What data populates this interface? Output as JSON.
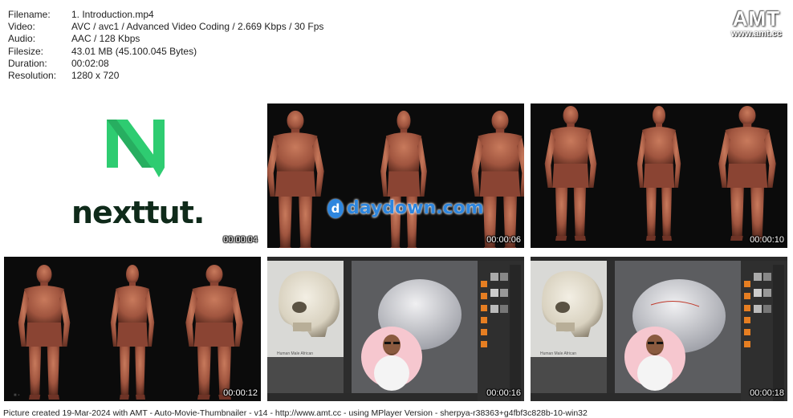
{
  "info": {
    "rows": [
      {
        "k": "Filename:",
        "v": "1. Introduction.mp4"
      },
      {
        "k": "Video:",
        "v": "AVC / avc1 / Advanced Video Coding / 2.669 Kbps / 30 Fps"
      },
      {
        "k": "Audio:",
        "v": "AAC / 128 Kbps"
      },
      {
        "k": "Filesize:",
        "v": "43.01 MB (45.100.045 Bytes)"
      },
      {
        "k": "Duration:",
        "v": "00:02:08"
      },
      {
        "k": "Resolution:",
        "v": "1280 x 720"
      }
    ]
  },
  "watermark": {
    "big": "AMT",
    "small": "www.amt.cc"
  },
  "thumbs": [
    {
      "time": "00:00:04",
      "logo_text": "nexttut."
    },
    {
      "time": "00:00:06",
      "overlay": "daydown.com"
    },
    {
      "time": "00:00:10"
    },
    {
      "time": "00:00:12"
    },
    {
      "time": "00:00:16",
      "caption": "Human Male African"
    },
    {
      "time": "00:00:18",
      "caption": "Human Male African"
    }
  ],
  "footer": "Picture created 19-Mar-2024 with AMT - Auto-Movie-Thumbnailer - v14 - http://www.amt.cc - using MPlayer Version - sherpya-r38363+g4fbf3c828b-10-win32",
  "colors": {
    "brand_green": "#2ecc71",
    "logo_dark": "#0f2a1a",
    "skin": "#a0553f",
    "daydown_blue": "#2e86de"
  }
}
